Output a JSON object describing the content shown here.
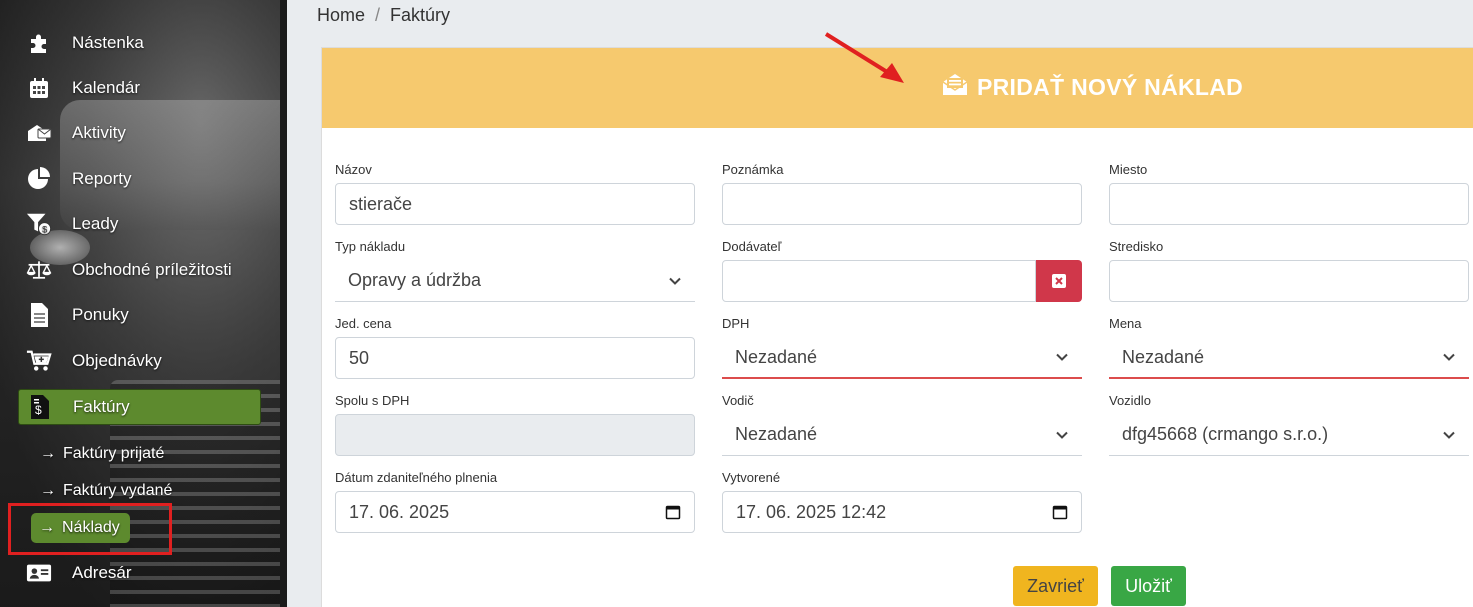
{
  "sidebar": {
    "items": [
      {
        "label": "Nástenka",
        "icon": "puzzle-icon"
      },
      {
        "label": "Kalendár",
        "icon": "calendar-icon"
      },
      {
        "label": "Aktivity",
        "icon": "activities-icon"
      },
      {
        "label": "Reporty",
        "icon": "pie-chart-icon"
      },
      {
        "label": "Leady",
        "icon": "funnel-dollar-icon"
      },
      {
        "label": "Obchodné príležitosti",
        "icon": "balance-scale-icon"
      },
      {
        "label": "Ponuky",
        "icon": "document-icon"
      },
      {
        "label": "Objednávky",
        "icon": "cart-plus-icon"
      },
      {
        "label": "Faktúry",
        "icon": "invoice-dollar-icon"
      },
      {
        "label": "Adresár",
        "icon": "address-card-icon"
      }
    ],
    "subitems": [
      {
        "label": "Faktúry prijaté"
      },
      {
        "label": "Faktúry vydané"
      },
      {
        "label": "Náklady"
      }
    ],
    "active_color": "#5d8a2e"
  },
  "breadcrumb": {
    "home": "Home",
    "separator": "/",
    "current": "Faktúry"
  },
  "form": {
    "title": "PRIDAŤ NOVÝ NÁKLAD",
    "header_color": "#f6c96e",
    "nazov": {
      "label": "Názov",
      "value": "stierače"
    },
    "poznamka": {
      "label": "Poznámka",
      "value": ""
    },
    "miesto": {
      "label": "Miesto",
      "value": ""
    },
    "typ_nakladu": {
      "label": "Typ nákladu",
      "value": "Opravy a údržba"
    },
    "dodavatel": {
      "label": "Dodávateľ",
      "value": ""
    },
    "stredisko": {
      "label": "Stredisko",
      "value": ""
    },
    "jed_cena": {
      "label": "Jed. cena",
      "value": "50"
    },
    "dph": {
      "label": "DPH",
      "value": "Nezadané"
    },
    "mena": {
      "label": "Mena",
      "value": "Nezadané"
    },
    "spolu_s_dph": {
      "label": "Spolu s DPH",
      "value": ""
    },
    "vodic": {
      "label": "Vodič",
      "value": "Nezadané"
    },
    "vozidlo": {
      "label": "Vozidlo",
      "value": "dfg45668 (crmango s.r.o.)"
    },
    "datum_zdanitelneho_plnenia": {
      "label": "Dátum zdaniteľného plnenia",
      "value": "17. 06. 2025"
    },
    "vytvorene": {
      "label": "Vytvorené",
      "value": "17. 06. 2025 12:42"
    },
    "close_label": "Zavrieť",
    "save_label": "Uložiť"
  }
}
